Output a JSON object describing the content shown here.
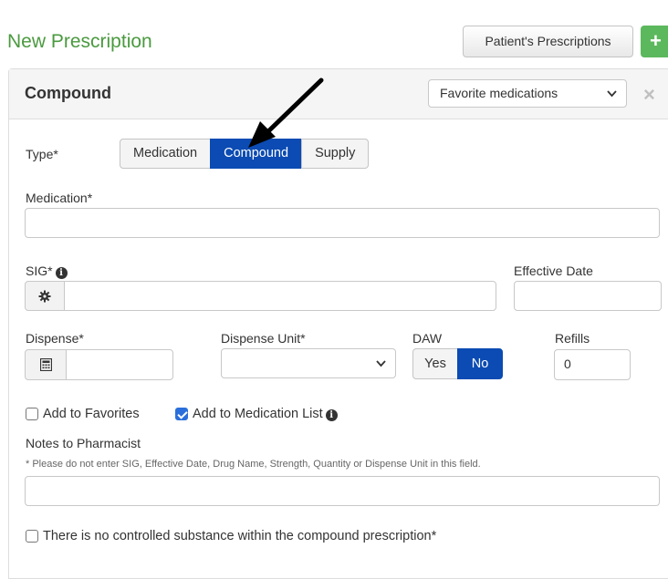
{
  "header": {
    "title": "New Prescription",
    "patient_prescriptions_label": "Patient's Prescriptions",
    "add_icon": "plus-icon",
    "add_symbol": "+"
  },
  "panel": {
    "title": "Compound",
    "favorites_select": {
      "value": "Favorite medications"
    },
    "close_symbol": "×"
  },
  "form": {
    "type_label": "Type*",
    "type_options": [
      "Medication",
      "Compound",
      "Supply"
    ],
    "type_selected": "Compound",
    "medication_label": "Medication*",
    "medication_value": "",
    "sig_label": "SIG*",
    "sig_value": "",
    "effective_date_label": "Effective Date",
    "effective_date_value": "",
    "dispense_label": "Dispense*",
    "dispense_value": "",
    "dispense_unit_label": "Dispense Unit*",
    "dispense_unit_value": "",
    "daw_label": "DAW",
    "daw_options": [
      "Yes",
      "No"
    ],
    "daw_selected": "No",
    "refills_label": "Refills",
    "refills_value": "0",
    "add_to_favorites_label": "Add to Favorites",
    "add_to_favorites_checked": false,
    "add_to_med_list_label": "Add to Medication List",
    "add_to_med_list_checked": true,
    "notes_label": "Notes to Pharmacist",
    "notes_hint": "* Please do not enter SIG, Effective Date, Drug Name, Strength, Quantity or Dispense Unit in this field.",
    "notes_value": "",
    "controlled_label": "There is no controlled substance within the compound prescription*",
    "controlled_checked": false
  },
  "colors": {
    "title_green": "#4a9a3f",
    "active_blue": "#0b4bb3",
    "add_green": "#5cb85c"
  }
}
